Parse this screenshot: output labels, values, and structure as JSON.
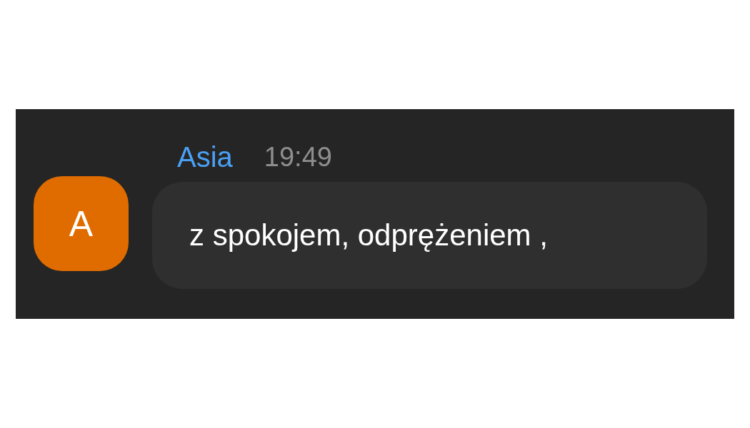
{
  "message": {
    "avatar_letter": "A",
    "sender": "Asia",
    "time": "19:49",
    "text": "z spokojem, odprężeniem ,"
  }
}
